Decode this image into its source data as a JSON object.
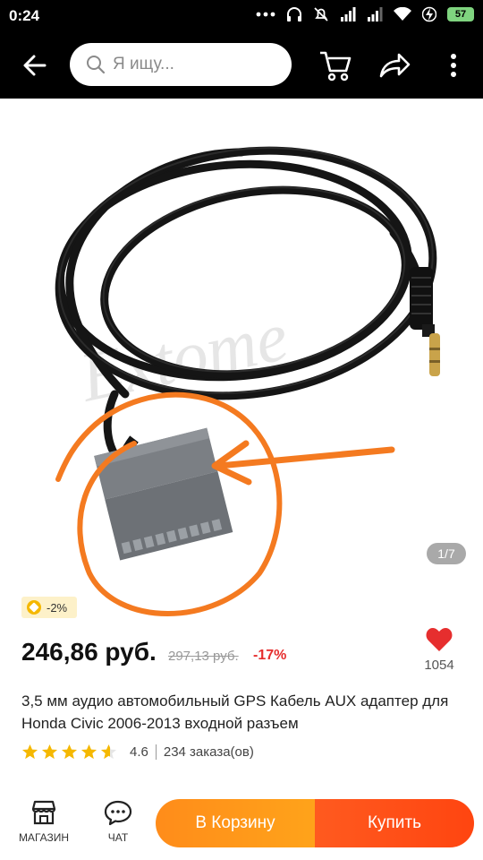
{
  "status_bar": {
    "time": "0:24",
    "battery": "57",
    "icons": [
      "more-dots-icon",
      "headphones-icon",
      "mute-icon",
      "signal-icon",
      "signal-icon",
      "wifi-icon",
      "bolt-icon",
      "battery-icon"
    ]
  },
  "app_bar": {
    "search_placeholder": "Я ищу...",
    "icons": [
      "back-arrow-icon",
      "search-icon",
      "cart-icon",
      "share-icon",
      "more-vertical-icon"
    ]
  },
  "gallery": {
    "counter": "1/7",
    "watermark": "Extome"
  },
  "coin_badge": {
    "text": "-2%"
  },
  "price": {
    "current": "246,86 руб.",
    "old": "297,13 руб.",
    "discount": "-17%"
  },
  "wishlist": {
    "count": "1054"
  },
  "product": {
    "title": "3,5 мм аудио автомобильный GPS Кабель AUX адаптер для Honda Civic 2006-2013 входной разъем"
  },
  "rating": {
    "value": "4.6",
    "stars": 4.6,
    "orders": "234 заказа(ов)"
  },
  "bottom_bar": {
    "store_label": "МАГАЗИН",
    "chat_label": "ЧАТ",
    "add_to_cart": "В Корзину",
    "buy": "Купить"
  },
  "colors": {
    "accent_orange": "#ff8c1a",
    "buy_red": "#ff4510",
    "discount_red": "#e62e2e",
    "annotation_orange": "#f47a20"
  }
}
